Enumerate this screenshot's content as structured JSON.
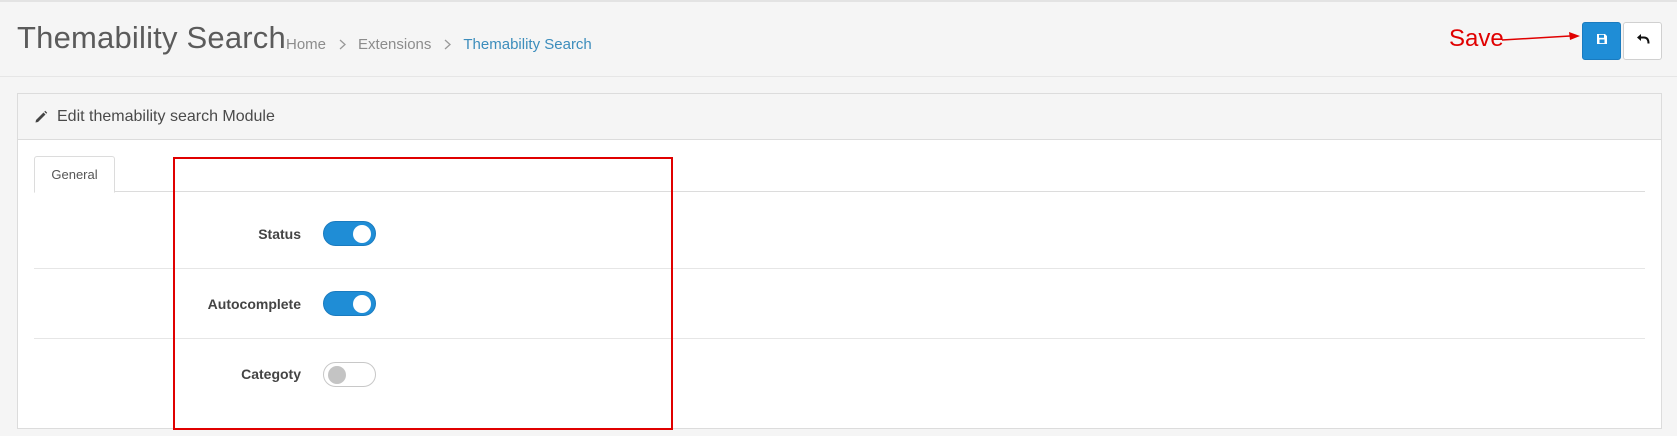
{
  "header": {
    "title": "Themability Search",
    "breadcrumb": [
      "Home",
      "Extensions",
      "Themability Search"
    ],
    "save_tooltip": "Save",
    "back_tooltip": "Back"
  },
  "annotation": {
    "save_label": "Save",
    "color": "#e00000"
  },
  "panel": {
    "heading": "Edit themability search Module",
    "tabs": [
      {
        "label": "General"
      }
    ]
  },
  "form": {
    "fields": [
      {
        "label": "Status",
        "enabled": true
      },
      {
        "label": "Autocomplete",
        "enabled": true
      },
      {
        "label": "Categoty",
        "enabled": false
      }
    ]
  },
  "colors": {
    "accent": "#1f8dd6",
    "breadcrumb_active": "#3c8dbc",
    "annotation": "#e00000"
  },
  "icons": {
    "save": "floppy-disk-icon",
    "back": "reply-arrow-icon",
    "heading": "pencil-icon",
    "breadcrumb_separator": "chevron-right-icon"
  }
}
